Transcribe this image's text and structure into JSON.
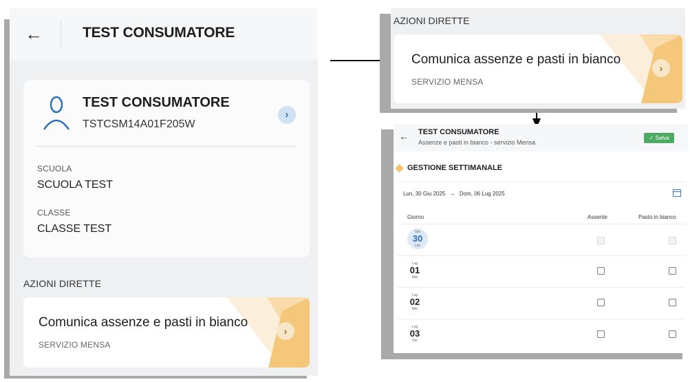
{
  "left_panel": {
    "header_title": "TEST CONSUMATORE",
    "user": {
      "name": "TEST CONSUMATORE",
      "code": "TSTCSM14A01F205W"
    },
    "school_label": "SCUOLA",
    "school_value": "SCUOLA TEST",
    "class_label": "CLASSE",
    "class_value": "CLASSE TEST",
    "section_title": "AZIONI DIRETTE",
    "action": {
      "title": "Comunica assenze e pasti in bianco",
      "subtitle": "SERVIZIO MENSA"
    }
  },
  "right_top_panel": {
    "section_title": "AZIONI DIRETTE",
    "action": {
      "title": "Comunica assenze e pasti in bianco",
      "subtitle": "SERVIZIO MENSA"
    }
  },
  "right_bottom_panel": {
    "header_title": "TEST CONSUMATORE",
    "header_subtitle": "Assenze e pasti in bianco - servizio Mensa",
    "save_label": "✓ Salva",
    "section_title": "GESTIONE SETTIMANALE",
    "range_start": "Lun, 30 Giu 2025",
    "range_arrow": "→",
    "range_end": "Dom, 06 Lug 2025",
    "columns": {
      "day": "Giorno",
      "absent": "Assente",
      "blank_meal": "Pasto in bianco"
    },
    "rows": [
      {
        "month": "Giu",
        "day": "30",
        "weekday": "Lun",
        "today": true,
        "enabled": false
      },
      {
        "month": "Lug",
        "day": "01",
        "weekday": "Mar",
        "today": false,
        "enabled": true
      },
      {
        "month": "Lug",
        "day": "02",
        "weekday": "Mer",
        "today": false,
        "enabled": true
      },
      {
        "month": "Lug",
        "day": "03",
        "weekday": "Gio",
        "today": false,
        "enabled": true
      }
    ]
  },
  "colors": {
    "accent_blue": "#2b6fb7",
    "save_green": "#4caa62",
    "deco_orange": "#f5c77a",
    "panel_gray": "#eef0f2",
    "shadow_gray": "#a9a9a9"
  },
  "icons": {
    "back": "arrow-left-icon",
    "user": "user-icon",
    "chevron": "chevron-right-icon",
    "calendar": "calendar-icon",
    "section_marker": "diamond-icon"
  }
}
